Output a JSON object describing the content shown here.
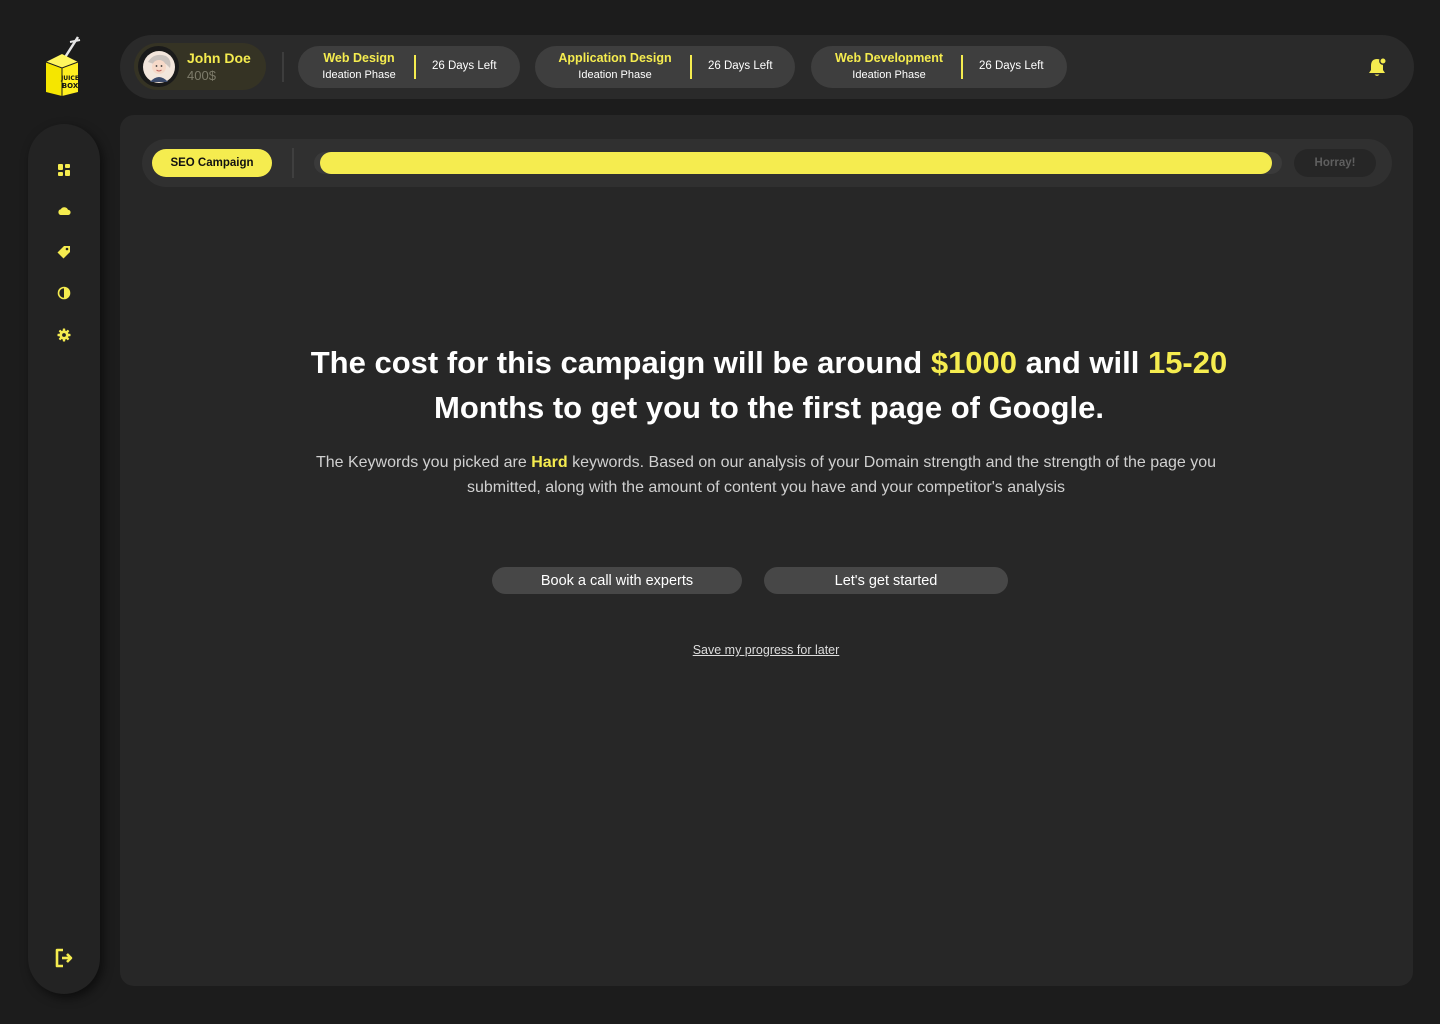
{
  "logo": {
    "text_line1": "JUICE",
    "text_line2": "BOX"
  },
  "sidebar": {
    "items": [
      {
        "icon": "dashboard-icon"
      },
      {
        "icon": "cloud-icon"
      },
      {
        "icon": "tag-icon"
      },
      {
        "icon": "contrast-icon"
      },
      {
        "icon": "gear-icon"
      }
    ],
    "logout_icon": "logout-icon"
  },
  "user": {
    "name": "John Doe",
    "balance": "400$"
  },
  "projects": [
    {
      "title": "Web Design",
      "phase": "Ideation Phase",
      "days_left": "26 Days Left"
    },
    {
      "title": "Application Design",
      "phase": "Ideation Phase",
      "days_left": "26 Days Left"
    },
    {
      "title": "Web Development",
      "phase": "Ideation Phase",
      "days_left": "26 Days Left"
    }
  ],
  "progress": {
    "step_label": "SEO Campaign",
    "end_label": "Horray!",
    "percent": 99
  },
  "headline": {
    "part1": "The cost for this campaign will be around ",
    "cost": "$1000",
    "part2": " and will ",
    "duration": "15-20",
    "part3": " Months to get you to the first page of Google."
  },
  "description": {
    "part1": "The Keywords you picked are ",
    "difficulty": "Hard",
    "part2": " keywords. Based on our analysis of your Domain strength and the strength of the page you submitted, along with the amount of content you have and your competitor's analysis"
  },
  "actions": {
    "book_call": "Book a call with experts",
    "get_started": "Let's get started",
    "save_later": "Save my progress for later"
  },
  "colors": {
    "accent": "#f5ec4f",
    "background": "#1c1c1c",
    "panel": "#272727"
  }
}
